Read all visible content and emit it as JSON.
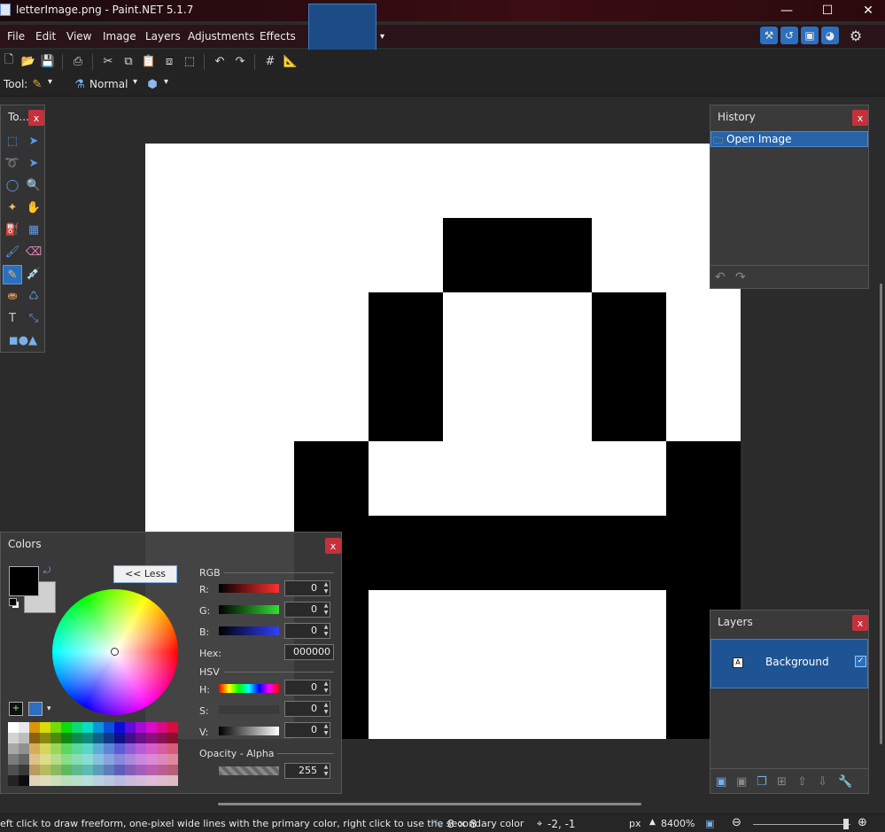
{
  "window": {
    "title": "letterImage.png - Paint.NET 5.1.7",
    "minimize": "—",
    "maximize": "☐",
    "close": "✕"
  },
  "menu": [
    "File",
    "Edit",
    "View",
    "Image",
    "Layers",
    "Adjustments",
    "Effects"
  ],
  "toolbar": {
    "tool_label": "Tool:",
    "blend_mode": "Normal"
  },
  "tools_panel": {
    "title": "To...",
    "close": "x"
  },
  "history": {
    "title": "History",
    "close": "x",
    "items": [
      "Open Image"
    ]
  },
  "layers": {
    "title": "Layers",
    "close": "x",
    "items": [
      {
        "name": "Background",
        "visible": true
      }
    ]
  },
  "colors": {
    "title": "Colors",
    "close": "x",
    "less_button": "<< Less",
    "rgb_section": "RGB",
    "hsv_section": "HSV",
    "alpha_section": "Opacity - Alpha",
    "r_label": "R:",
    "g_label": "G:",
    "b_label": "B:",
    "hex_label": "Hex:",
    "h_label": "H:",
    "s_label": "S:",
    "v_label": "V:",
    "r": "0",
    "g": "0",
    "b": "0",
    "hex": "000000",
    "h": "0",
    "s": "0",
    "v": "0",
    "alpha": "255",
    "primary": "#000000",
    "secondary": "#d0d0d0"
  },
  "status": {
    "hint": "eft click to draw freeform, one-pixel wide lines with the primary color, right click to use the secondary color",
    "image_size": "8 × 8",
    "cursor_pos": "-2, -1",
    "units": "px",
    "zoom": "8400%"
  }
}
